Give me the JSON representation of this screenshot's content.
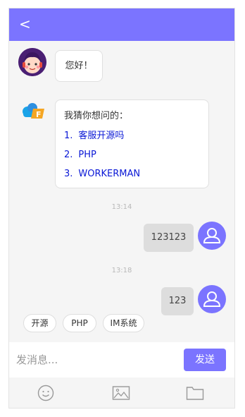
{
  "header": {
    "back_label": "<"
  },
  "messages": {
    "greeting": "您好！",
    "suggest_title": "我猜你想问的：",
    "suggestions": [
      {
        "num": "1.",
        "text": "客服开源吗"
      },
      {
        "num": "2.",
        "text": "PHP"
      },
      {
        "num": "3.",
        "text": "WORKERMAN"
      }
    ],
    "time1": "13:14",
    "user_msg1": "123123",
    "time2": "13:18",
    "user_msg2": "123"
  },
  "quick_tags": [
    "开源",
    "PHP",
    "IM系统"
  ],
  "input": {
    "placeholder": "发消息...",
    "value": ""
  },
  "send_label": "发送",
  "colors": {
    "accent": "#7b74ff",
    "link": "#0a18d6",
    "user_bubble": "#dddddd"
  },
  "icons": [
    "emoji-icon",
    "image-icon",
    "folder-icon"
  ]
}
